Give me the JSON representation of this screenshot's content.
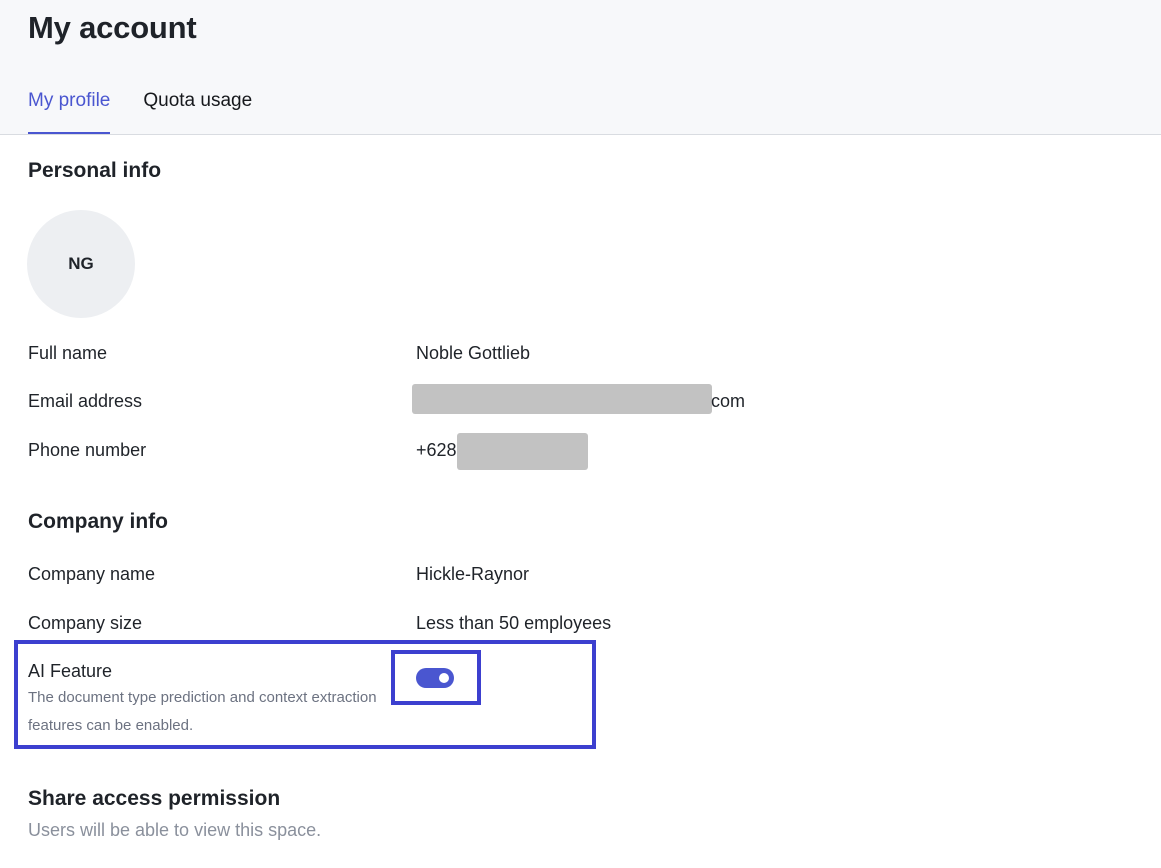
{
  "page": {
    "title": "My account"
  },
  "tabs": [
    {
      "label": "My profile",
      "active": true
    },
    {
      "label": "Quota usage",
      "active": false
    }
  ],
  "personal_info": {
    "heading": "Personal info",
    "avatar_initials": "NG",
    "full_name_label": "Full name",
    "full_name_value": "Noble Gottlieb",
    "email_label": "Email address",
    "email_visible_suffix": "com",
    "phone_label": "Phone number",
    "phone_visible_prefix": "+628"
  },
  "company_info": {
    "heading": "Company info",
    "name_label": "Company name",
    "name_value": "Hickle-Raynor",
    "size_label": "Company size",
    "size_value": "Less than 50 employees",
    "ai_feature_label": "AI Feature",
    "ai_feature_description": "The document type prediction and context extraction features can be enabled.",
    "ai_feature_enabled": true
  },
  "share_access": {
    "heading": "Share access permission",
    "description": "Users will be able to view this space."
  },
  "colors": {
    "accent": "#4a56d0",
    "highlight": "#3c3fcf",
    "header_bg": "#f7f8fa",
    "redaction": "#c2c2c2"
  }
}
